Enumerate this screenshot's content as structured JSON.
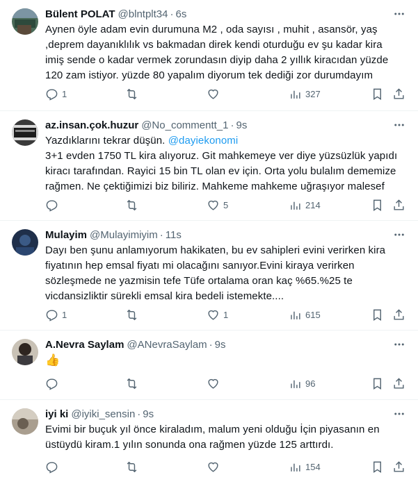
{
  "tweets": [
    {
      "name": "Bülent POLAT",
      "handle": "@blntplt34",
      "time": "6s",
      "lines": [
        "Aynen öyle adam evin durumuna M2 , oda sayısı , muhit , asansör, yaş",
        ",deprem dayanıklılık vs bakmadan direk kendi oturduğu ev şu kadar kira",
        "imiş sende o kadar vermek zorundasın diyip daha 2 yıllık kiracıdan yüzde",
        "120 zam istiyor. yüzde 80 yapalım diyorum tek dediği zor durumdayım"
      ],
      "replies": "1",
      "retweets": "",
      "likes": "",
      "views": "327"
    },
    {
      "name": "az.insan.çok.huzur",
      "handle": "@No_commentt_1",
      "time": "9s",
      "reply_prefix": "Yazdıklarını tekrar düşün. ",
      "mention": "@dayiekonomi",
      "lines": [
        "3+1 evden 1750 TL kira alıyoruz. Git mahkemeye ver diye yüzsüzlük yapıdı",
        "kiracı tarafından. Rayici 15 bin TL olan ev için. Orta yolu bulalım dememize",
        "rağmen. Ne çektiğimizi biz biliriz. Mahkeme mahkeme uğraşıyor malesef"
      ],
      "replies": "",
      "retweets": "",
      "likes": "5",
      "views": "214"
    },
    {
      "name": "Mulayim",
      "handle": "@Mulayimiyim",
      "time": "11s",
      "lines": [
        "Dayı ben şunu anlamıyorum hakikaten, bu ev sahipleri evini verirken kira",
        "fiyatının hep emsal fiyatı mi olacağını sanıyor.Evini kiraya verirken",
        "sözleşmede ne yazmisin tefe Tüfe ortalama oran kaç %65.%25 te",
        "vicdansizliktir sürekli emsal kira bedeli istemekte...."
      ],
      "replies": "1",
      "retweets": "",
      "likes": "1",
      "views": "615"
    },
    {
      "name": "A.Nevra Saylam",
      "handle": "@ANevraSaylam",
      "time": "9s",
      "lines": [
        "👍"
      ],
      "replies": "",
      "retweets": "",
      "likes": "",
      "views": "96"
    },
    {
      "name": "iyi ki",
      "handle": "@iyiki_sensin",
      "time": "9s",
      "lines": [
        "Evimi bir buçuk yıl önce kiraladım, malum yeni olduğu İçin piyasanın en",
        "üstüydü kiram.1 yılın sonunda ona rağmen yüzde 125 arttırdı."
      ],
      "replies": "",
      "retweets": "",
      "likes": "",
      "views": "154"
    }
  ],
  "separator": "·",
  "colors": {
    "text": "#0f1419",
    "secondary": "#536471",
    "link": "#1d9bf0",
    "border": "#eff3f4"
  }
}
